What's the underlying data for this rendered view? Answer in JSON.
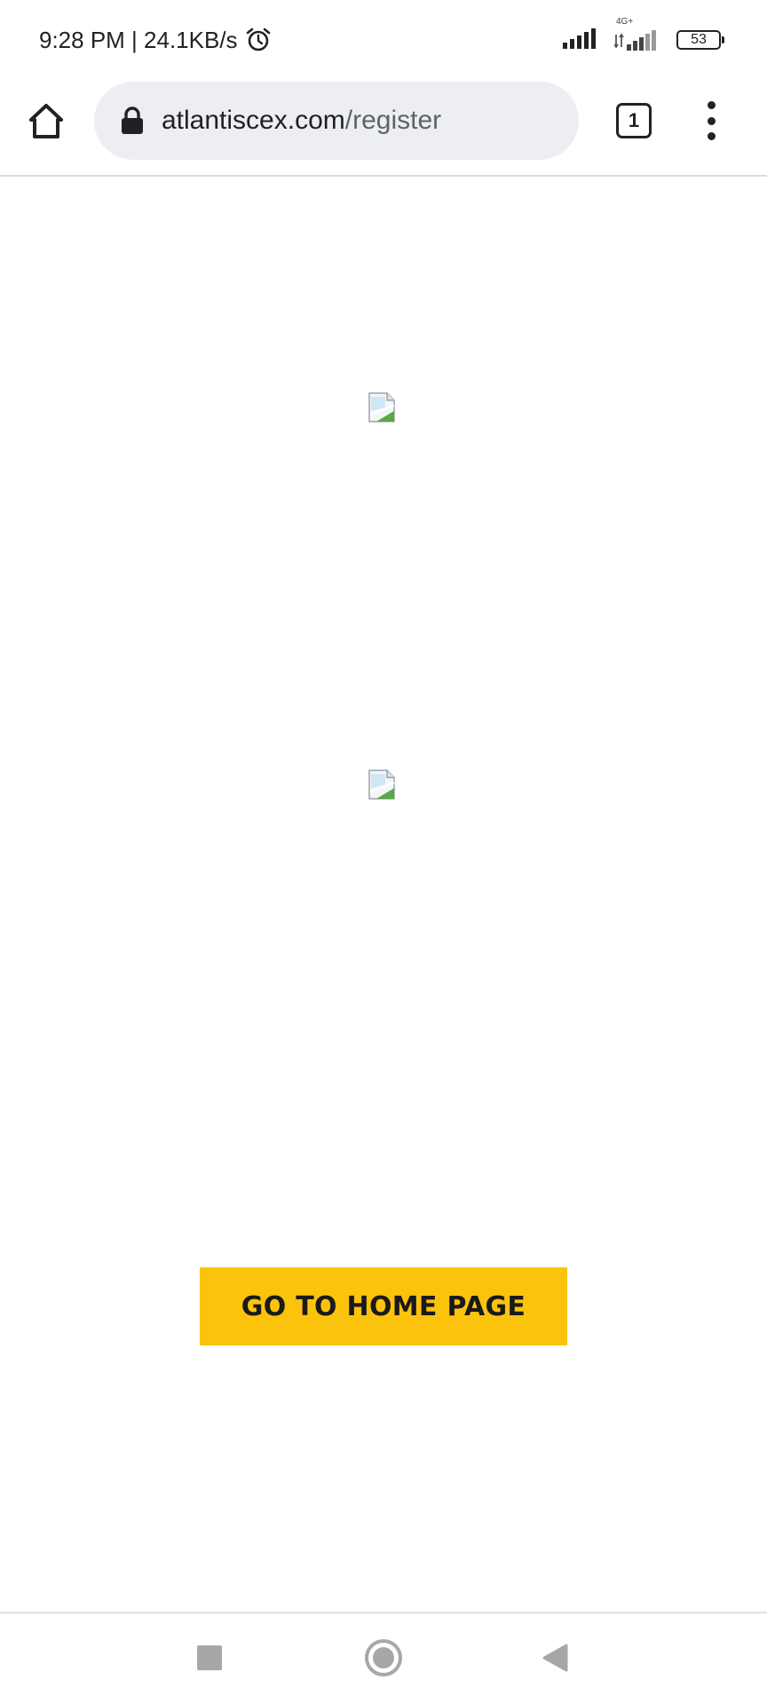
{
  "status_bar": {
    "time_speed": "9:28 PM | 24.1KB/s",
    "network_type": "4G+",
    "battery_level": "53",
    "icons": [
      "alarm-icon",
      "signal-icon",
      "signal-4g-icon",
      "battery-icon"
    ]
  },
  "browser": {
    "url_domain": "atlantiscex.com",
    "url_path": "/register",
    "tab_count": "1",
    "icons": [
      "home-icon",
      "lock-icon",
      "tabs-icon",
      "more-vert-icon"
    ]
  },
  "page": {
    "images": [
      "broken-image-icon",
      "broken-image-icon"
    ],
    "button_label": "GO TO HOME PAGE",
    "button_color": "#fcc30d"
  },
  "nav_bar": {
    "icons": [
      "recent-apps-icon",
      "home-circle-icon",
      "back-triangle-icon"
    ],
    "color": "#a7a7a7"
  }
}
